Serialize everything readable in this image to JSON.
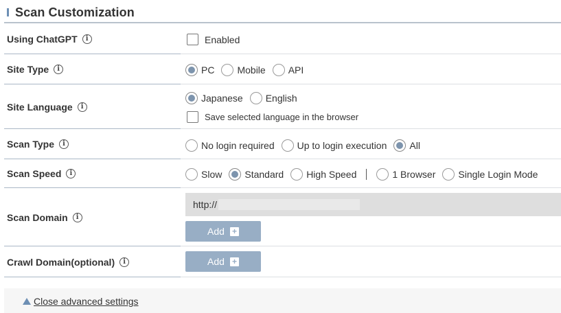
{
  "section": {
    "title": "Scan Customization"
  },
  "info_glyph": "i",
  "rows": {
    "chatgpt": {
      "label": "Using ChatGPT",
      "checkbox_label": "Enabled",
      "checked": false
    },
    "site_type": {
      "label": "Site Type",
      "options": [
        "PC",
        "Mobile",
        "API"
      ],
      "selected": "PC"
    },
    "site_language": {
      "label": "Site Language",
      "options": [
        "Japanese",
        "English"
      ],
      "selected": "Japanese",
      "save_label": "Save selected language in the browser",
      "save_checked": false
    },
    "scan_type": {
      "label": "Scan Type",
      "options": [
        "No login required",
        "Up to login execution",
        "All"
      ],
      "selected": "All"
    },
    "scan_speed": {
      "label": "Scan Speed",
      "options": [
        "Slow",
        "Standard",
        "High Speed"
      ],
      "selected": "Standard",
      "browser_options": [
        "1 Browser",
        "Single Login Mode"
      ],
      "browser_selected": ""
    },
    "scan_domain": {
      "label": "Scan Domain",
      "url_value": "http://",
      "add_label": "Add"
    },
    "crawl_domain": {
      "label": "Crawl Domain(optional)",
      "add_label": "Add"
    }
  },
  "footer": {
    "toggle_label": "Close advanced settings"
  },
  "colors": {
    "accent": "#6d8fb4",
    "button": "#98aec5",
    "radio_fill": "#7d94ad"
  },
  "icons": {
    "info": "info-circle-icon",
    "plus": "plus-icon",
    "collapse": "triangle-up-icon"
  }
}
